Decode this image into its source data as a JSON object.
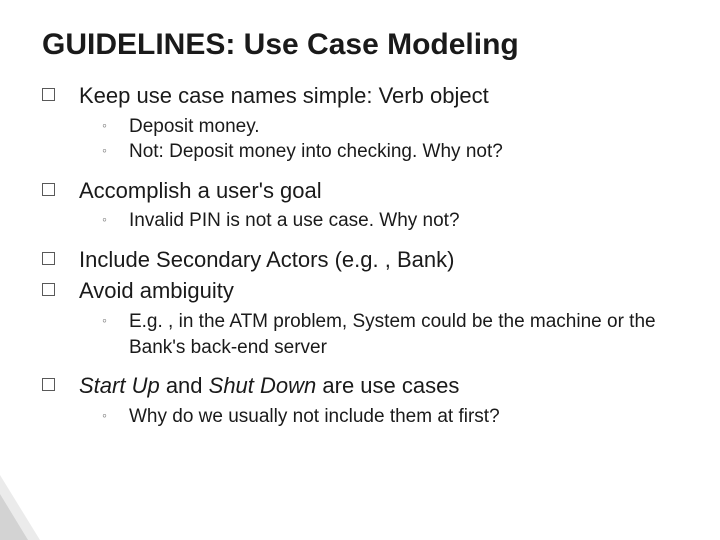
{
  "title": "GUIDELINES: Use Case Modeling",
  "items": {
    "i0": "Keep use case names simple: Verb object",
    "i0_s0": "Deposit money.",
    "i0_s1": "Not: Deposit money into checking.  Why not?",
    "i1": "Accomplish a user's goal",
    "i1_s0": "Invalid PIN is not a use case.   Why not?",
    "i2": "Include Secondary Actors (e.g. , Bank)",
    "i3": "Avoid ambiguity",
    "i3_s0": "E.g. , in the ATM problem, System could be the machine or the Bank's back-end server",
    "i4_a": "Start Up",
    "i4_b": " and ",
    "i4_c": "Shut Down",
    "i4_d": " are use cases",
    "i4_s0": "Why do we usually not include them at first?"
  }
}
